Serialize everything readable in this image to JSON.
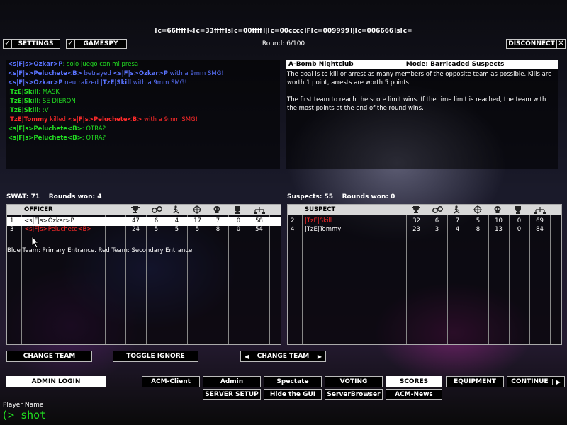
{
  "header": {
    "title_string": "[c=66ffff]«[c=33ffff]s[c=00ffff]|[c=00cccc]F[c=009999]|[c=006666]s[c=",
    "round": "Round: 6/100",
    "settings_label": "SETTINGS",
    "gamespy_label": "GAMESPY",
    "disconnect_label": "DISCONNECT",
    "check_mark": "✓",
    "close_mark": "✕"
  },
  "chat": [
    {
      "parts": [
        {
          "text": "<s|F|s>Ozkar>P",
          "color": "#5a73ff",
          "bold": true
        },
        {
          "text": ": solo juego con mi presa",
          "color": "#22dd22"
        }
      ]
    },
    {
      "parts": [
        {
          "text": "<s|F|s>Peluchete<B>",
          "color": "#5a73ff",
          "bold": true
        },
        {
          "text": " betrayed ",
          "color": "#5a73ff"
        },
        {
          "text": "<s|F|s>Ozkar>P",
          "color": "#5a73ff",
          "bold": true
        },
        {
          "text": " with a 9mm SMG!",
          "color": "#5a73ff"
        }
      ]
    },
    {
      "parts": [
        {
          "text": "<s|F|s>Ozkar>P",
          "color": "#5a73ff",
          "bold": true
        },
        {
          "text": " neutralized ",
          "color": "#5a73ff"
        },
        {
          "text": "|TzE|Skill",
          "color": "#5a73ff",
          "bold": true
        },
        {
          "text": " with a 9mm SMG!",
          "color": "#5a73ff"
        }
      ]
    },
    {
      "parts": [
        {
          "text": "|TzE|Skill",
          "color": "#22dd22",
          "bold": true
        },
        {
          "text": ": MASK",
          "color": "#22dd22"
        }
      ]
    },
    {
      "parts": [
        {
          "text": "|TzE|Skill",
          "color": "#22dd22",
          "bold": true
        },
        {
          "text": ": SE DIERON",
          "color": "#22dd22"
        }
      ]
    },
    {
      "parts": [
        {
          "text": "|TzE|Skill",
          "color": "#22dd22",
          "bold": true
        },
        {
          "text": ": :V",
          "color": "#22dd22"
        }
      ]
    },
    {
      "parts": [
        {
          "text": "|TzE|Tommy",
          "color": "#ff2a2a",
          "bold": true
        },
        {
          "text": " killed ",
          "color": "#ff2a2a"
        },
        {
          "text": "<s|F|s>Peluchete<B>",
          "color": "#ff2a2a",
          "bold": true
        },
        {
          "text": " with a 9mm SMG!",
          "color": "#ff2a2a"
        }
      ]
    },
    {
      "parts": [
        {
          "text": "<s|F|s>Peluchete<B>",
          "color": "#22dd22",
          "bold": true
        },
        {
          "text": ": OTRA?",
          "color": "#22dd22"
        }
      ]
    },
    {
      "parts": [
        {
          "text": "<s|F|s>Peluchete<B>",
          "color": "#22dd22",
          "bold": true
        },
        {
          "text": ": OTRA?",
          "color": "#22dd22"
        }
      ]
    }
  ],
  "map_info": {
    "map_name": "A-Bomb Nightclub",
    "mode": "Mode: Barricaded Suspects",
    "description": "The goal is to kill or arrest as many members of the opposite team as possible.  Kills are worth 1 point, arrests are worth 5 points.\n\nThe first team to reach the score limit wins.  If the time limit is reached, the team with the most points at the end of the round wins."
  },
  "swat": {
    "label": "SWAT: 71",
    "rounds": "Rounds won: 4",
    "column_header": "OFFICER",
    "rows": [
      {
        "num": "1",
        "name": "<s|F|s>Ozkar>P",
        "name_color": "#000000",
        "values": [
          "47",
          "6",
          "4",
          "17",
          "7",
          "0",
          "58"
        ],
        "selected": true
      },
      {
        "num": "3",
        "name": "<s|F|s>Peluchete<B>",
        "name_color": "#ff2a2a",
        "values": [
          "24",
          "5",
          "5",
          "5",
          "8",
          "0",
          "54"
        ],
        "selected": false
      }
    ],
    "note": "Blue Team: Primary Entrance. Red Team: Secondary Entrance"
  },
  "suspects": {
    "label": "Suspects: 55",
    "rounds": "Rounds won: 0",
    "column_header": "SUSPECT",
    "rows": [
      {
        "num": "2",
        "name": "|TzE|Skill",
        "name_color": "#ff2a2a",
        "values": [
          "32",
          "6",
          "7",
          "5",
          "10",
          "0",
          "69"
        ],
        "selected": false
      },
      {
        "num": "4",
        "name": "|TzE|Tommy",
        "name_color": "#ffffff",
        "values": [
          "23",
          "3",
          "4",
          "8",
          "13",
          "0",
          "84"
        ],
        "selected": false
      }
    ]
  },
  "stat_icons": [
    "trophy-icon",
    "handcuffs-icon",
    "arrest-figure-icon",
    "crosshair-icon",
    "skull-icon",
    "award-icon",
    "ping-network-icon"
  ],
  "buttons": {
    "change_team_left": "CHANGE TEAM",
    "toggle_ignore": "TOGGLE IGNORE",
    "change_team_right": "CHANGE TEAM",
    "admin_login": "ADMIN LOGIN",
    "acm_client": "ACM-Client",
    "admin": "Admin",
    "spectate": "Spectate",
    "voting": "VOTING",
    "scores": "SCORES",
    "equipment": "EQUIPMENT",
    "continue": "CONTINUE",
    "server_setup": "SERVER SETUP",
    "hide_gui": "Hide the GUI",
    "server_browser": "ServerBrowser",
    "acm_news": "ACM-News",
    "arrow_left": "◀",
    "arrow_right": "▶"
  },
  "console": {
    "player_name": "Player Name",
    "prompt": "(> shot_"
  }
}
